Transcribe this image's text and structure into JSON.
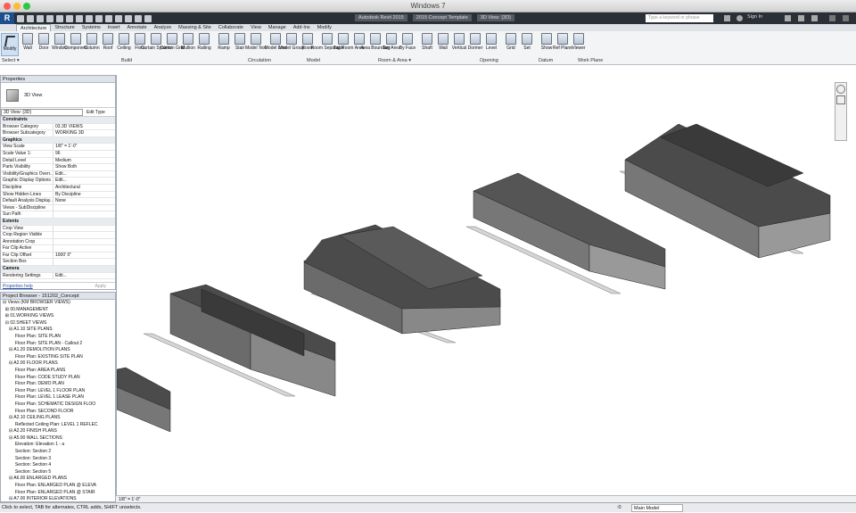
{
  "window": {
    "title": "Windows 7"
  },
  "qat": {
    "doc_titles": [
      "Autodesk Revit 2015",
      "2015 Concept Template",
      "3D View: {3D}"
    ],
    "search_placeholder": "Type a keyword or phrase",
    "signin": "Sign In"
  },
  "tabs": [
    "Architecture",
    "Structure",
    "Systems",
    "Insert",
    "Annotate",
    "Analyze",
    "Massing & Site",
    "Collaborate",
    "View",
    "Manage",
    "Add-Ins",
    "Modify"
  ],
  "ribbon": {
    "modify": "Modify",
    "tools": [
      "Wall",
      "Door",
      "Window",
      "Component",
      "Column",
      "Roof",
      "Ceiling",
      "Floor",
      "Curtain System",
      "Curtain Grid",
      "Mullion",
      "Railing",
      "Ramp",
      "Stair",
      "Model Text",
      "Model Line",
      "Model Group",
      "Room",
      "Room Separator",
      "Tag Room",
      "Area",
      "Area Boundary",
      "Tag Area",
      "By Face",
      "Shaft",
      "Wall",
      "Vertical",
      "Dormer",
      "Level",
      "Grid",
      "Set",
      "Show",
      "Ref Plane",
      "Viewer"
    ],
    "panels": [
      "Select ▾",
      "Build",
      "Circulation",
      "Model",
      "Room & Area ▾",
      "Opening",
      "Datum",
      "Work Plane"
    ]
  },
  "properties": {
    "header": "Properties",
    "type": "3D View",
    "selector": "3D View: {3D}",
    "edit_type": "Edit Type",
    "rows": [
      {
        "k": "Constraints",
        "v": "",
        "sec": true
      },
      {
        "k": "Browser Category",
        "v": "03.3D VIEWS"
      },
      {
        "k": "Browser Subcategory",
        "v": "WORKING 3D"
      },
      {
        "k": "Graphics",
        "v": "",
        "sec": true
      },
      {
        "k": "View Scale",
        "v": "1/8\" = 1'-0\""
      },
      {
        "k": "Scale Value 1:",
        "v": "96"
      },
      {
        "k": "Detail Level",
        "v": "Medium"
      },
      {
        "k": "Parts Visibility",
        "v": "Show Both"
      },
      {
        "k": "Visibility/Graphics Overr...",
        "v": "Edit..."
      },
      {
        "k": "Graphic Display Options",
        "v": "Edit..."
      },
      {
        "k": "Discipline",
        "v": "Architectural"
      },
      {
        "k": "Show Hidden Lines",
        "v": "By Discipline"
      },
      {
        "k": "Default Analysis Display...",
        "v": "None"
      },
      {
        "k": "Views - SubDiscipline",
        "v": ""
      },
      {
        "k": "Sun Path",
        "v": ""
      },
      {
        "k": "Extents",
        "v": "",
        "sec": true
      },
      {
        "k": "Crop View",
        "v": ""
      },
      {
        "k": "Crop Region Visible",
        "v": ""
      },
      {
        "k": "Annotation Crop",
        "v": ""
      },
      {
        "k": "Far Clip Active",
        "v": ""
      },
      {
        "k": "Far Clip Offset",
        "v": "1000' 0\""
      },
      {
        "k": "Section Box",
        "v": ""
      },
      {
        "k": "Camera",
        "v": "",
        "sec": true
      },
      {
        "k": "Rendering Settings",
        "v": "Edit..."
      }
    ],
    "help": "Properties help",
    "apply": "Apply"
  },
  "browser": {
    "header": "Project Browser - 151202_Concept",
    "items": [
      "⊟ Views (KM BROWSER VIEWS)",
      "  ⊞ 00.MANAGEMENT",
      "  ⊞ 01.WORKING VIEWS",
      "  ⊟ 02.SHEET VIEWS",
      "     ⊟ A1.10 SITE PLANS",
      "          Floor Plan: SITE PLAN",
      "          Floor Plan: SITE PLAN - Callout 2",
      "     ⊟ A1.20 DEMOLITION PLANS",
      "          Floor Plan: EXISTING SITE PLAN",
      "     ⊟ A2.00 FLOOR PLANS",
      "          Floor Plan: AREA PLANS",
      "          Floor Plan: CODE STUDY PLAN",
      "          Floor Plan: DEMO PLAN",
      "          Floor Plan: LEVEL 1 FLOOR PLAN",
      "          Floor Plan: LEVEL 1 LEASE PLAN",
      "          Floor Plan: SCHEMATIC DESIGN FLOO",
      "          Floor Plan: SECOND FLOOR",
      "     ⊟ A2.10 CEILING PLANS",
      "          Reflected Ceiling Plan: LEVEL 1 REFLEC",
      "     ⊟ A2.20 FINISH PLANS",
      "     ⊟ A5.00 WALL SECTIONS",
      "          Elevation: Elevation 1 - a",
      "          Section: Section 2",
      "          Section: Section 3",
      "          Section: Section 4",
      "          Section: Section 5",
      "     ⊟ A6.00 ENLARGED PLANS",
      "          Floor Plan: ENLARGED PLAN @ ELEVA",
      "          Floor Plan: ENLARGED PLAN @ STAIR",
      "     ⊟ A7.00 INTERIOR ELEVATIONS"
    ]
  },
  "view_status": {
    "scale": "1/8\" = 1'-0\""
  },
  "status": {
    "message": "Click to select, TAB for alternates, CTRL adds, SHIFT unselects.",
    "model": "Main Model",
    "zero": ":0"
  },
  "colors": {
    "accent": "#1d4f8f",
    "ribbon": "#f3f4f6"
  }
}
